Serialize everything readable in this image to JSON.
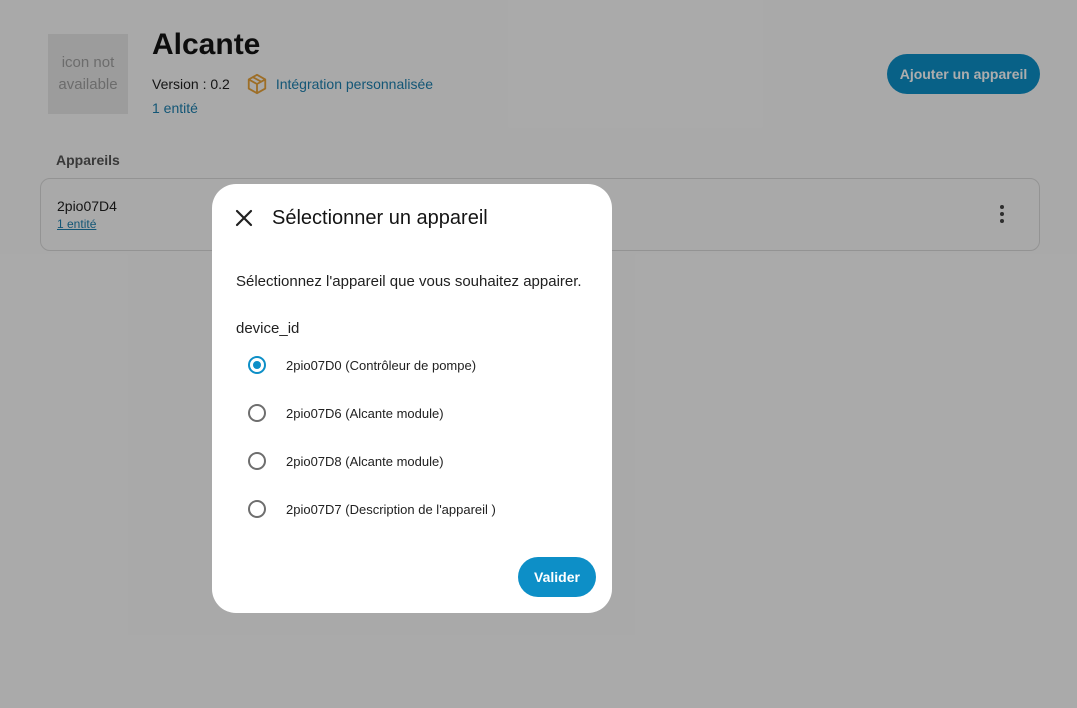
{
  "integration": {
    "icon_placeholder": "icon not available",
    "title": "Alcante",
    "version": "Version : 0.2",
    "custom_label": "Intégration personnalisée",
    "entity_count": "1 entité",
    "add_device_label": "Ajouter un appareil"
  },
  "devices_section": {
    "label": "Appareils",
    "items": [
      {
        "name": "2pio07D4",
        "entities": "1 entité"
      }
    ]
  },
  "dialog": {
    "title": "Sélectionner un appareil",
    "description": "Sélectionnez l'appareil que vous souhaitez appairer.",
    "field_label": "device_id",
    "options": [
      {
        "label": "2pio07D0 (Contrôleur de pompe)",
        "selected": true
      },
      {
        "label": "2pio07D6 (Alcante module)",
        "selected": false
      },
      {
        "label": "2pio07D8 (Alcante module)",
        "selected": false
      },
      {
        "label": "2pio07D7 (Description de l'appareil )",
        "selected": false
      }
    ],
    "submit_label": "Valider"
  },
  "colors": {
    "accent": "#0d8fc7",
    "link": "#1c7fae",
    "custom_icon": "#e8a33a",
    "scrim": "rgba(0,0,0,0.32)"
  },
  "icons": {
    "close": "close-icon",
    "custom": "custom-integration-icon",
    "overflow": "more-vertical-icon"
  }
}
